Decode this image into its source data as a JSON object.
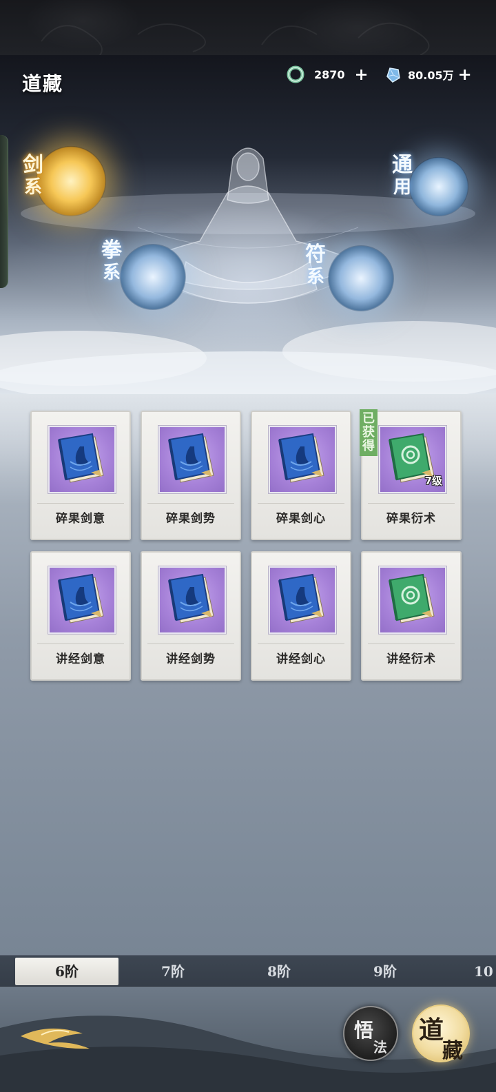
{
  "header": {
    "title": "道藏",
    "resources": [
      {
        "icon": "jade-ring-icon",
        "value": "2870"
      },
      {
        "icon": "spirit-crystal-icon",
        "value": "80.05万"
      }
    ],
    "plus_label": "+"
  },
  "schools": {
    "jian": {
      "line1": "剑",
      "line2": "系"
    },
    "tong": {
      "line1": "通",
      "line2": "用"
    },
    "quan": {
      "line1": "拳",
      "line2": "系"
    },
    "fu": {
      "line1": "符",
      "line2": "系"
    }
  },
  "cards": [
    {
      "name": "碎果剑意",
      "book": "blue"
    },
    {
      "name": "碎果剑势",
      "book": "blue"
    },
    {
      "name": "碎果剑心",
      "book": "blue"
    },
    {
      "name": "碎果衍术",
      "book": "green",
      "acquired": "已获得",
      "level": "7级"
    },
    {
      "name": "讲经剑意",
      "book": "blue"
    },
    {
      "name": "讲经剑势",
      "book": "blue"
    },
    {
      "name": "讲经剑心",
      "book": "blue"
    },
    {
      "name": "讲经衍术",
      "book": "green"
    }
  ],
  "tiers": [
    "6阶",
    "7阶",
    "8阶",
    "9阶",
    "10"
  ],
  "active_tier": "6阶",
  "bottom_buttons": {
    "wufa": {
      "a": "悟",
      "b": "法"
    },
    "daozang": {
      "a": "道",
      "b": "藏"
    }
  },
  "colors": {
    "acquired_badge": "#6fae63",
    "gold_glow": "#f6c756",
    "book_blue": "#2f68c6",
    "book_green": "#3faa6c"
  }
}
